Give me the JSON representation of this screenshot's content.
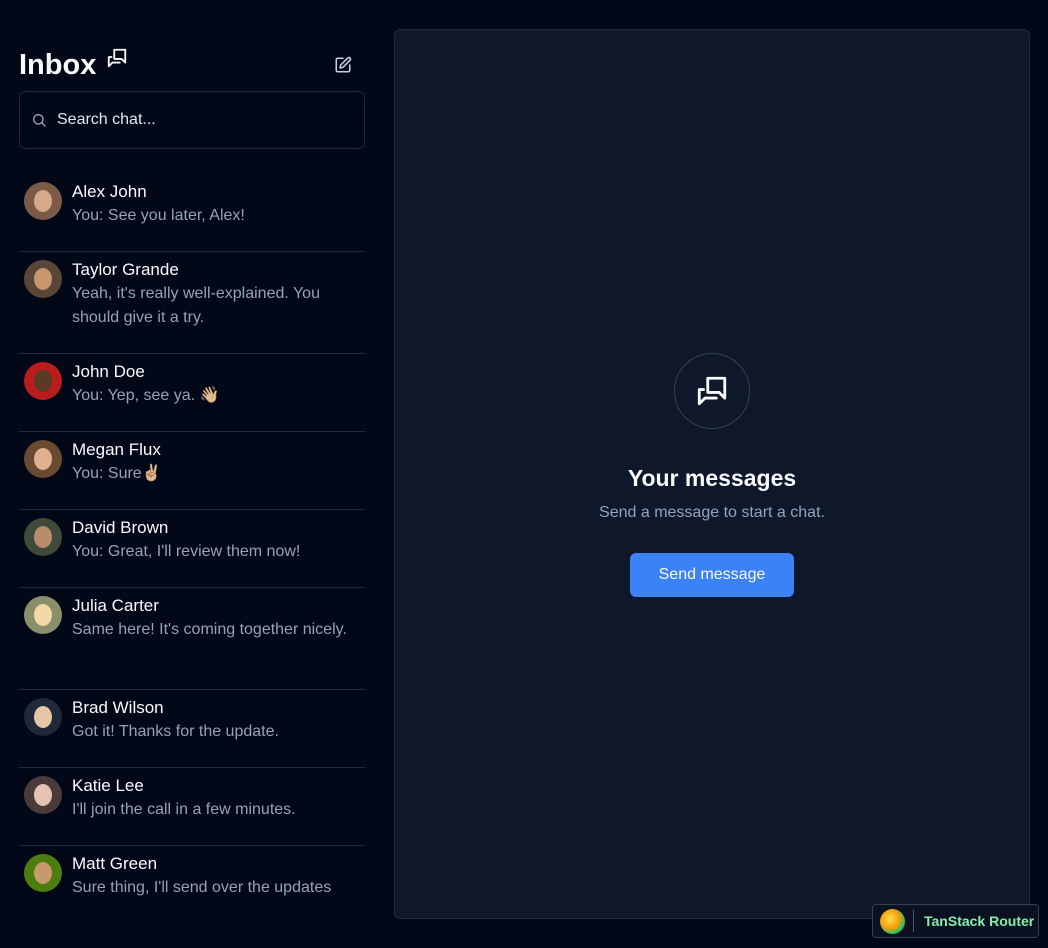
{
  "sidebar": {
    "title": "Inbox",
    "search": {
      "placeholder": "Search chat...",
      "value": ""
    },
    "chats": [
      {
        "name": "Alex John",
        "message": "You: See you later, Alex!",
        "avatar_color": "#7c5a48",
        "face_color": "#d6a98a"
      },
      {
        "name": "Taylor Grande",
        "message": "Yeah, it's really well-explained. You should give it a try.",
        "avatar_color": "#5a4636",
        "face_color": "#c8956f"
      },
      {
        "name": "John Doe",
        "message": "You: Yep, see ya. 👋🏼",
        "avatar_color": "#b91c1c",
        "face_color": "#5b3a24"
      },
      {
        "name": "Megan Flux",
        "message": "You: Sure✌🏼",
        "avatar_color": "#6b4a32",
        "face_color": "#e0b090"
      },
      {
        "name": "David Brown",
        "message": "You: Great, I'll review them now!",
        "avatar_color": "#3f4a3a",
        "face_color": "#b98d6a"
      },
      {
        "name": "Julia Carter",
        "message": "Same here! It's coming together nicely.",
        "avatar_color": "#8a8f6a",
        "face_color": "#f3d9a8"
      },
      {
        "name": "Brad Wilson",
        "message": "Got it! Thanks for the update.",
        "avatar_color": "#1f2937",
        "face_color": "#e5c7a8"
      },
      {
        "name": "Katie Lee",
        "message": "I'll join the call in a few minutes.",
        "avatar_color": "#4b3a3a",
        "face_color": "#e8c2b0"
      },
      {
        "name": "Matt Green",
        "message": "Sure thing, I'll send over the updates",
        "avatar_color": "#4d7c0f",
        "face_color": "#c79a6e"
      }
    ]
  },
  "main": {
    "empty_title": "Your messages",
    "empty_subtitle": "Send a message to start a chat.",
    "send_button_label": "Send message"
  },
  "badge": {
    "label": "TanStack Router"
  },
  "colors": {
    "background": "#020817",
    "panel": "#0f172a",
    "border": "#1e293b",
    "accent": "#3b82f6",
    "muted_text": "#94a3b8"
  }
}
